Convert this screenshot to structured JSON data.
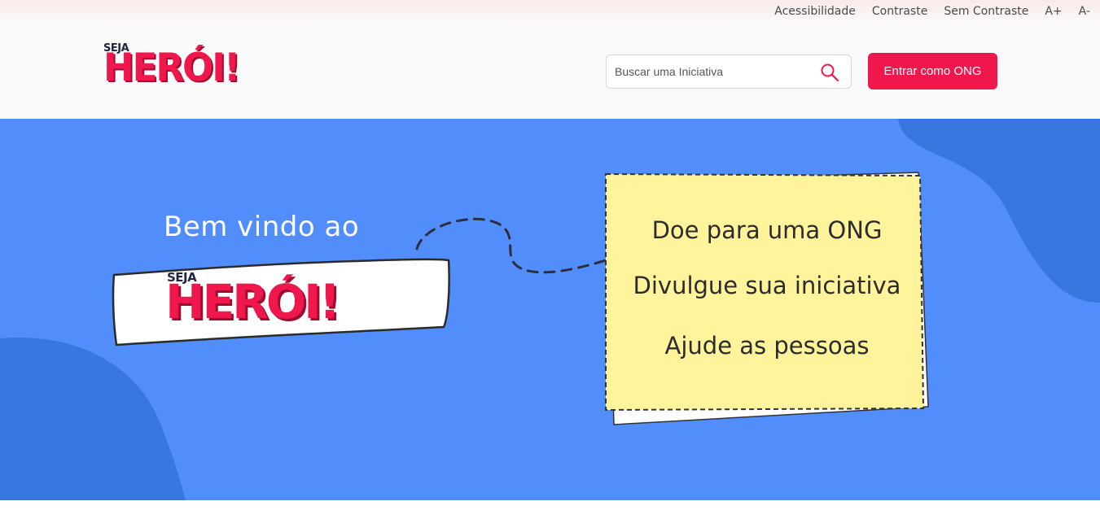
{
  "accessibility_bar": {
    "links": [
      "Acessibilidade",
      "Contraste",
      "Sem Contraste",
      "A+",
      "A-"
    ]
  },
  "header": {
    "logo": {
      "small": "SEJA",
      "big": "HERÓI!"
    },
    "search": {
      "placeholder": "Buscar uma Iniciativa",
      "icon": "search-icon"
    },
    "cta_label": "Entrar como ONG"
  },
  "hero": {
    "welcome": "Bem vindo ao",
    "badge": {
      "small": "SEJA",
      "big": "HERÓI!"
    },
    "note_items": [
      "Doe para uma ONG",
      "Divulgue sua iniciativa",
      "Ajude as pessoas"
    ]
  },
  "colors": {
    "brand": "#f0174c",
    "hero_bg": "#528dfc",
    "blob": "#3677e0",
    "note": "#fff39c"
  }
}
